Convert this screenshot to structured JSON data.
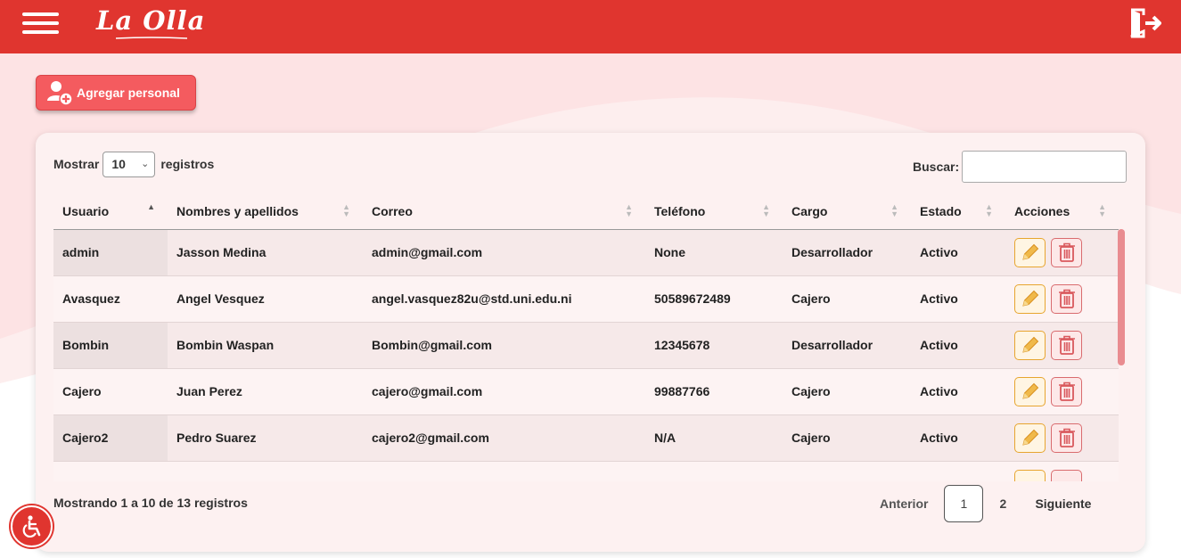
{
  "header": {
    "logo_text": "La Olla",
    "menu_icon": "hamburger-menu-icon",
    "logout_icon": "logout-icon",
    "brand_color": "#e0352f"
  },
  "toolbar": {
    "add_label": "Agregar personal",
    "add_icon": "add-user-icon"
  },
  "table_controls": {
    "show_label": "Mostrar",
    "page_size": "10",
    "records_label": "registros",
    "search_label": "Buscar:",
    "search_value": ""
  },
  "table": {
    "columns": [
      "Usuario",
      "Nombres y apellidos",
      "Correo",
      "Teléfono",
      "Cargo",
      "Estado",
      "Acciones"
    ],
    "rows": [
      {
        "usuario": "admin",
        "nombre": "Jasson Medina",
        "correo": "admin@gmail.com",
        "telefono": "None",
        "cargo": "Desarrollador",
        "estado": "Activo"
      },
      {
        "usuario": "Avasquez",
        "nombre": "Angel Vesquez",
        "correo": "angel.vasquez82u@std.uni.edu.ni",
        "telefono": "50589672489",
        "cargo": "Cajero",
        "estado": "Activo"
      },
      {
        "usuario": "Bombin",
        "nombre": "Bombin Waspan",
        "correo": "Bombin@gmail.com",
        "telefono": "12345678",
        "cargo": "Desarrollador",
        "estado": "Activo"
      },
      {
        "usuario": "Cajero",
        "nombre": "Juan Perez",
        "correo": "cajero@gmail.com",
        "telefono": "99887766",
        "cargo": "Cajero",
        "estado": "Activo"
      },
      {
        "usuario": "Cajero2",
        "nombre": "Pedro Suarez",
        "correo": "cajero2@gmail.com",
        "telefono": "N/A",
        "cargo": "Cajero",
        "estado": "Activo"
      }
    ],
    "action_icons": [
      "pencil-icon",
      "trash-icon"
    ]
  },
  "footer": {
    "info": "Mostrando 1 a 10 de 13 registros",
    "prev_label": "Anterior",
    "pages": [
      "1",
      "2"
    ],
    "active_page": "1",
    "next_label": "Siguiente"
  },
  "accessibility": {
    "icon": "wheelchair-icon"
  }
}
